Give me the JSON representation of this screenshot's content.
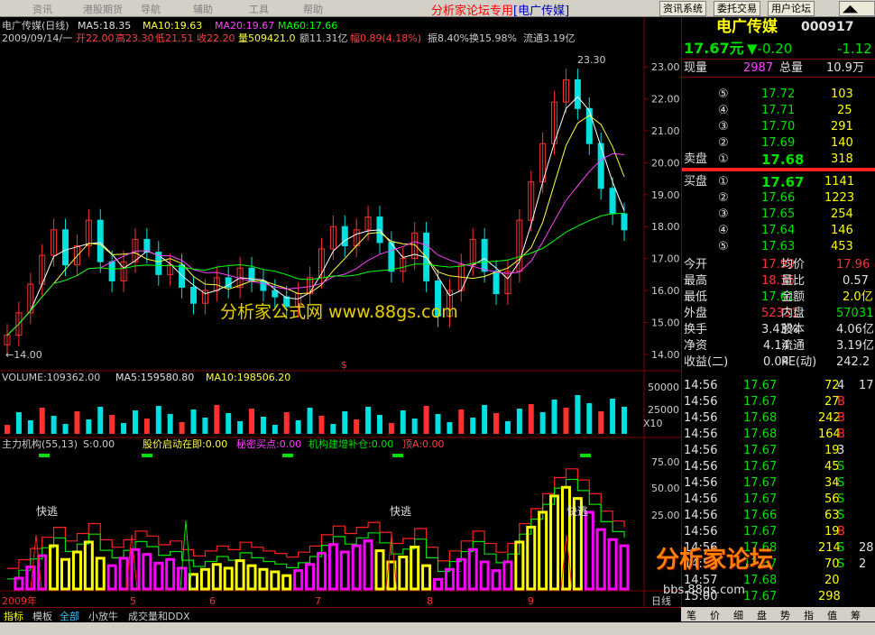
{
  "menu": {
    "items": [
      "资讯",
      "港股期货",
      "导航",
      "辅助",
      "工具",
      "帮助"
    ],
    "buttons": [
      "资讯系统",
      "委托交易",
      "用户论坛"
    ],
    "brand": "分析家论坛专用",
    "brand_tag": "[电广传媒]"
  },
  "chart_header": {
    "stock_line": "电广传媒(日线)",
    "ma5": "MA5:18.35",
    "ma10": "MA10:19.63",
    "ma20": "MA20:19.67",
    "ma60": "MA60:17.66",
    "info_line": "2009/09/14/一",
    "open": "开22.00",
    "high": "高23.30",
    "low": "低21.51",
    "close": "收22.20",
    "vol": "量509421.0",
    "amount": "额11.31亿",
    "amp": "幅0.89(4.18%)",
    "swing": "振8.40%",
    "turnover": "换15.98%",
    "float": "流通3.19亿",
    "high_label": "23.30",
    "low_label": "←14.00",
    "watermark": "分析家公式网 www.88gs.com",
    "s_marker": "$"
  },
  "volume_header": {
    "vol": "VOLUME:109362.00",
    "ma5": "MA5:159580.80",
    "ma10": "MA10:198506.20"
  },
  "indicator_header": {
    "name": "主力机构(55,13)",
    "s": "S:0.00",
    "t1": "股价启动在即:0.00",
    "t2": "秘密买点:0.00",
    "t3": "机构建增补仓:0.00",
    "t4": "顶A:0.00",
    "escape_label": "快逃"
  },
  "axis": {
    "price_ticks": [
      "23.00",
      "22.00",
      "21.00",
      "20.00",
      "19.00",
      "18.00",
      "17.00",
      "16.00",
      "15.00",
      "14.00"
    ],
    "vol_ticks": [
      "50000",
      "25000"
    ],
    "vol_unit": "X10",
    "ind_ticks": [
      "75.00",
      "50.00",
      "25.00"
    ],
    "months": [
      "2009年",
      "5",
      "6",
      "7",
      "8",
      "9"
    ],
    "period": "日线"
  },
  "chart_data": {
    "type": "candlestick",
    "title": "电广传媒(日线)",
    "ylim": [
      13.6,
      23.6
    ],
    "x": [
      "2009-04",
      "2009-05",
      "2009-06",
      "2009-07",
      "2009-08",
      "2009-09"
    ],
    "close_series": [
      14.6,
      15.3,
      16.2,
      17.1,
      17.9,
      16.8,
      17.4,
      18.2,
      16.9,
      16.3,
      16.9,
      17.6,
      17.2,
      16.5,
      16.8,
      16.1,
      15.6,
      16.0,
      16.4,
      16.1,
      16.7,
      16.3,
      16.0,
      15.8,
      15.5,
      15.9,
      16.4,
      17.3,
      18.0,
      17.4,
      17.9,
      18.3,
      17.5,
      16.6,
      17.0,
      17.8,
      16.3,
      15.2,
      16.0,
      16.8,
      17.6,
      16.6,
      15.9,
      16.6,
      18.2,
      19.4,
      20.6,
      21.9,
      22.6,
      21.7,
      20.6,
      19.2,
      18.4,
      17.9
    ],
    "high": 23.3,
    "low": 14.0
  },
  "quote": {
    "name": "电广传媒",
    "code": "000917",
    "price": "17.67元",
    "change": "▼-0.20",
    "change_abs": "-1.12",
    "xianliang_label": "现量",
    "xianliang": "2987",
    "zongliang_label": "总量",
    "zongliang": "10.9万",
    "sell_label": "卖盘",
    "buy_label": "买盘",
    "asks": [
      {
        "idx": "⑤",
        "price": "17.72",
        "vol": "103"
      },
      {
        "idx": "④",
        "price": "17.71",
        "vol": "25"
      },
      {
        "idx": "③",
        "price": "17.70",
        "vol": "291"
      },
      {
        "idx": "②",
        "price": "17.69",
        "vol": "140"
      },
      {
        "idx": "①",
        "price": "17.68",
        "vol": "318"
      }
    ],
    "bids": [
      {
        "idx": "①",
        "price": "17.67",
        "vol": "1141"
      },
      {
        "idx": "②",
        "price": "17.66",
        "vol": "1223"
      },
      {
        "idx": "③",
        "price": "17.65",
        "vol": "254"
      },
      {
        "idx": "④",
        "price": "17.64",
        "vol": "146"
      },
      {
        "idx": "⑤",
        "price": "17.63",
        "vol": "453"
      }
    ],
    "stats": [
      {
        "l1": "今开",
        "v1": "17.99",
        "l2": "均价",
        "v2": "17.96",
        "c1": "r",
        "c2": "r"
      },
      {
        "l1": "最高",
        "v1": "18.35",
        "l2": "量比",
        "v2": "0.57",
        "c1": "r",
        "c2": "w"
      },
      {
        "l1": "最低",
        "v1": "17.61",
        "l2": "金额",
        "v2": "2.0亿",
        "c1": "g",
        "c2": "y"
      },
      {
        "l1": "外盘",
        "v1": "52331",
        "l2": "内盘",
        "v2": "57031",
        "c1": "r",
        "c2": "g"
      },
      {
        "l1": "换手",
        "v1": "3.43%",
        "l2": "股本",
        "v2": "4.06亿",
        "c1": "w",
        "c2": "w"
      },
      {
        "l1": "净资",
        "v1": "4.14",
        "l2": "流通",
        "v2": "3.19亿",
        "c1": "w",
        "c2": "w"
      },
      {
        "l1": "收益(二)",
        "v1": "0.04",
        "l2": "PE(动)",
        "v2": "242.2",
        "c1": "w",
        "c2": "w"
      }
    ],
    "ticks": [
      {
        "t": "14:56",
        "p": "17.67",
        "v": "72",
        "f": "4"
      },
      {
        "t": "14:56",
        "p": "17.67",
        "v": "27",
        "f": "B"
      },
      {
        "t": "14:56",
        "p": "17.68",
        "v": "242",
        "f": "B"
      },
      {
        "t": "14:56",
        "p": "17.68",
        "v": "164",
        "f": "B"
      },
      {
        "t": "14:56",
        "p": "17.67",
        "v": "19",
        "f": "3"
      },
      {
        "t": "14:56",
        "p": "17.67",
        "v": "45",
        "f": "S"
      },
      {
        "t": "14:56",
        "p": "17.67",
        "v": "34",
        "f": "S"
      },
      {
        "t": "14:56",
        "p": "17.67",
        "v": "56",
        "f": "S"
      },
      {
        "t": "14:56",
        "p": "17.66",
        "v": "63",
        "f": "S"
      },
      {
        "t": "14:56",
        "p": "17.67",
        "v": "19",
        "f": "B"
      },
      {
        "t": "14:56",
        "p": "17.68",
        "v": "214",
        "f": "S"
      },
      {
        "t": "14:57",
        "p": "17.67",
        "v": "70",
        "f": "S"
      },
      {
        "t": "14:57",
        "p": "17.68",
        "v": "20",
        "f": ""
      },
      {
        "t": "15:00",
        "p": "17.67",
        "v": "298",
        "f": ""
      }
    ],
    "tick_extra": [
      "17",
      "",
      "",
      "",
      "",
      "",
      "",
      "",
      "",
      "",
      "28",
      "2",
      "",
      ""
    ]
  },
  "bottom_tabs": [
    "指标",
    "模板",
    "全部",
    "小放牛",
    "成交量和DDX"
  ],
  "right_tabs": [
    "笔",
    "价",
    "细",
    "盘",
    "势",
    "指",
    "值",
    "筹"
  ],
  "watermark2": "分析家论坛",
  "watermark2_url": "bbs.88gs.com"
}
